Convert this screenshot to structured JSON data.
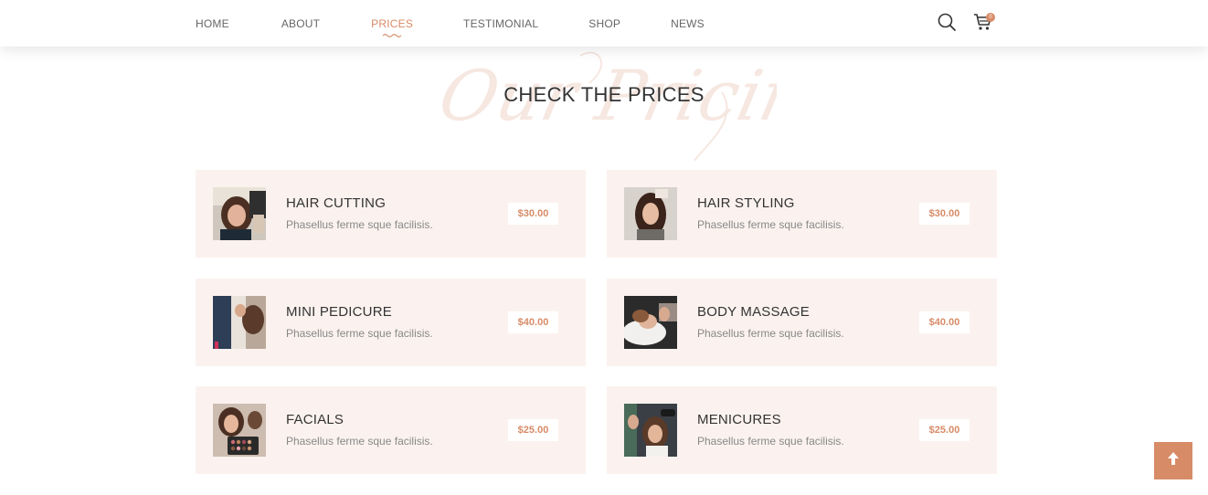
{
  "nav": {
    "items": [
      {
        "label": "HOME",
        "active": false
      },
      {
        "label": "ABOUT",
        "active": false
      },
      {
        "label": "PRICES",
        "active": true
      },
      {
        "label": "TESTIMONIAL",
        "active": false
      },
      {
        "label": "SHOP",
        "active": false
      },
      {
        "label": "NEWS",
        "active": false
      }
    ],
    "cart_count": "0"
  },
  "section": {
    "background_script": "Our Pricing",
    "title": "CHECK THE PRICES"
  },
  "prices": [
    {
      "name": "HAIR CUTTING",
      "desc": "Phasellus ferme sque facilisis.",
      "price": "$30.00",
      "image": "woman-haircut-photo"
    },
    {
      "name": "HAIR STYLING",
      "desc": "Phasellus ferme sque facilisis.",
      "price": "$30.00",
      "image": "woman-hair-styling-photo"
    },
    {
      "name": "MINI PEDICURE",
      "desc": "Phasellus ferme sque facilisis.",
      "price": "$40.00",
      "image": "salon-stylists-photo"
    },
    {
      "name": "BODY MASSAGE",
      "desc": "Phasellus ferme sque facilisis.",
      "price": "$40.00",
      "image": "hair-washing-photo"
    },
    {
      "name": "FACIALS",
      "desc": "Phasellus ferme sque facilisis.",
      "price": "$25.00",
      "image": "makeup-palette-photo"
    },
    {
      "name": "MENICURES",
      "desc": "Phasellus ferme sque facilisis.",
      "price": "$25.00",
      "image": "hair-dryer-photo"
    }
  ],
  "colors": {
    "accent": "#d78b67",
    "card_bg": "#fbf2ef",
    "text_dark": "#333333",
    "text_muted": "#888888"
  },
  "icons": {
    "search": "search-icon",
    "cart": "cart-icon",
    "back_to_top": "arrow-up-icon"
  }
}
